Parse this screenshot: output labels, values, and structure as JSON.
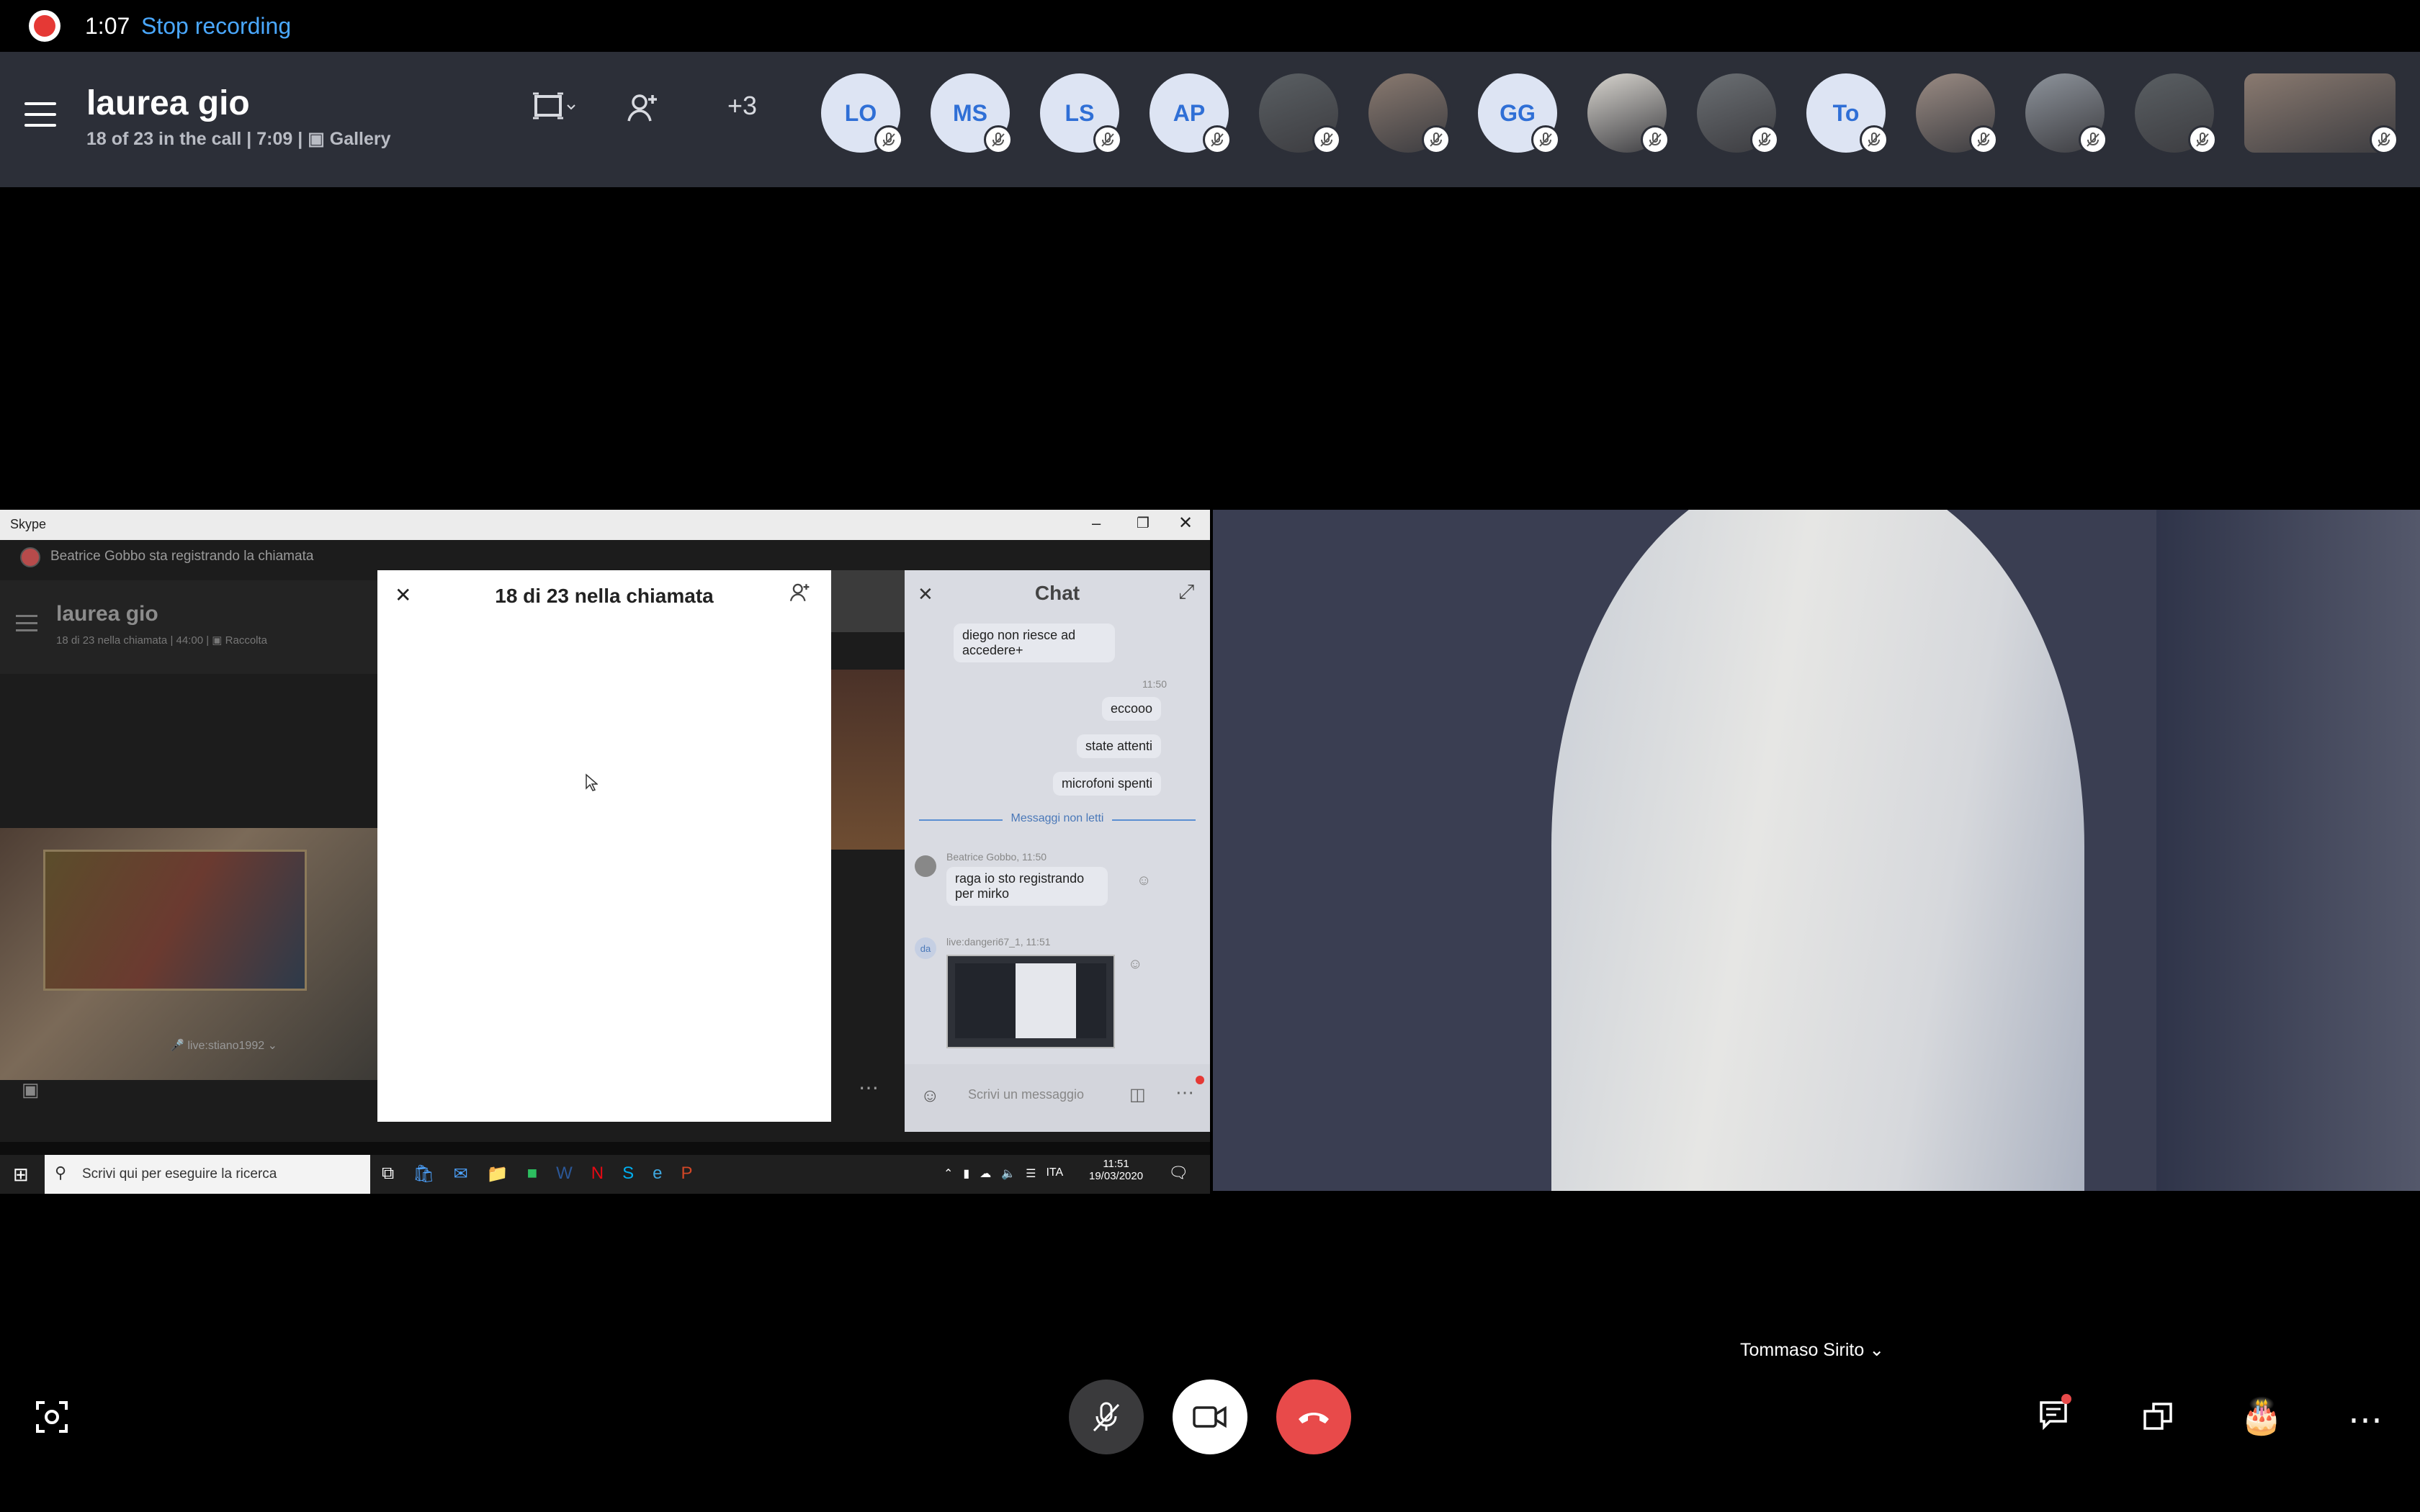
{
  "recording": {
    "time": "1:07",
    "stop_label": "Stop recording"
  },
  "call": {
    "title": "laurea gio",
    "subtitle": "18 of 23 in the call | 7:09",
    "view": "Gallery",
    "extra_count": "3"
  },
  "participants": [
    {
      "initials": "LO",
      "type": "initials",
      "muted": true
    },
    {
      "initials": "MS",
      "type": "initials",
      "muted": true
    },
    {
      "initials": "LS",
      "type": "initials",
      "muted": true
    },
    {
      "initials": "AP",
      "type": "initials",
      "muted": true
    },
    {
      "initials": "",
      "type": "photo",
      "muted": true
    },
    {
      "initials": "",
      "type": "photo",
      "muted": true
    },
    {
      "initials": "GG",
      "type": "initials",
      "muted": true
    },
    {
      "initials": "",
      "type": "photo",
      "muted": true
    },
    {
      "initials": "",
      "type": "photo",
      "muted": true
    },
    {
      "initials": "To",
      "type": "initials",
      "muted": true
    },
    {
      "initials": "",
      "type": "photo",
      "muted": true
    },
    {
      "initials": "",
      "type": "photo",
      "muted": true
    },
    {
      "initials": "",
      "type": "photo",
      "muted": true
    },
    {
      "initials": "",
      "type": "photo",
      "muted": true
    }
  ],
  "inner_window": {
    "title": "Skype",
    "recording_notice": "Beatrice Gobbo sta registrando la chiamata",
    "call_title": "laurea gio",
    "call_sub": "18 di 23 nella chiamata | 44:00",
    "view": "Raccolta",
    "tile_name": "live:stiano1992",
    "participants_panel_title": "18 di 23 nella chiamata",
    "chat": {
      "title": "Chat",
      "messages": [
        {
          "text": "diego non riesce ad accedere+"
        },
        {
          "time": "11:50"
        },
        {
          "text": "eccooo"
        },
        {
          "text": "state attenti"
        },
        {
          "text": "microfoni spenti"
        }
      ],
      "divider": "Messaggi non letti",
      "incoming": [
        {
          "sender": "Beatrice Gobbo, 11:50",
          "text": "raga io sto registrando per mirko"
        },
        {
          "sender": "live:dangeri67_1, 11:51",
          "text": ""
        }
      ],
      "avatar_initials": "da",
      "input_placeholder": "Scrivi un messaggio"
    },
    "taskbar": {
      "search_placeholder": "Scrivi qui per eseguire la ricerca",
      "lang": "ITA",
      "time": "11:51",
      "date": "19/03/2020"
    }
  },
  "main_video": {
    "name": "Tommaso Sirito"
  },
  "colors": {
    "header_bg": "#2c2f38",
    "accent": "#4aa8ff",
    "hangup": "#e84a4a",
    "record": "#e53935"
  }
}
